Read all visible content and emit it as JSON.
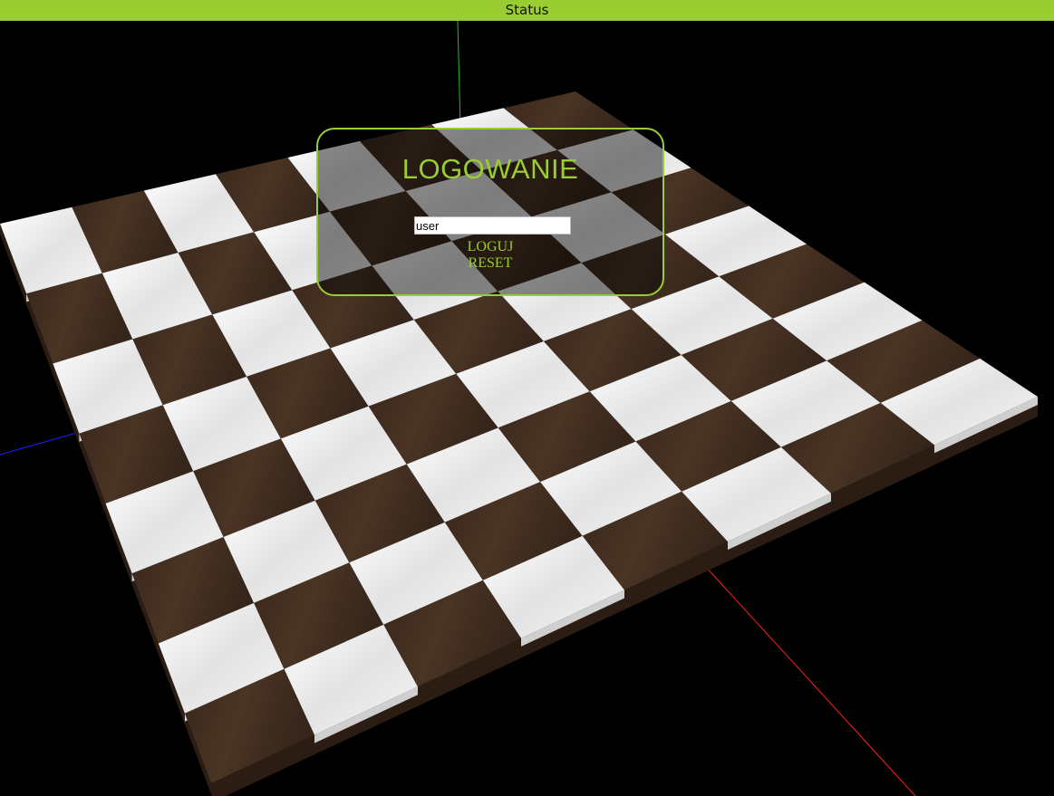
{
  "status_bar": {
    "label": "Status"
  },
  "login": {
    "title": "LOGOWANIE",
    "username_value": "user",
    "login_label": "LOGUJ",
    "reset_label": "RESET"
  },
  "scene": {
    "board": {
      "size": 8,
      "light_square": "#e9e9e9",
      "dark_square": "#3e2a1d"
    },
    "axes": {
      "x_color": "#ff2020",
      "y_color": "#20c020",
      "z_color": "#2020ff"
    }
  },
  "colors": {
    "accent": "#9acd32",
    "background": "#000000"
  }
}
